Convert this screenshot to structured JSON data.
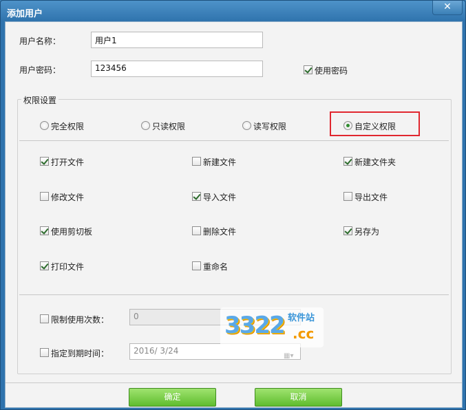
{
  "window": {
    "title": "添加用户",
    "close_glyph": "✕"
  },
  "username": {
    "label": "用户名称：",
    "value": "用户1"
  },
  "password": {
    "label": "用户密码：",
    "value": "123456",
    "use_password_label": "使用密码",
    "use_password_checked": true
  },
  "permissions": {
    "group_title": "权限设置",
    "modes": [
      {
        "label": "完全权限",
        "selected": false
      },
      {
        "label": "只读权限",
        "selected": false
      },
      {
        "label": "读写权限",
        "selected": false
      },
      {
        "label": "自定义权限",
        "selected": true
      }
    ],
    "items": [
      {
        "label": "打开文件",
        "checked": true
      },
      {
        "label": "新建文件",
        "checked": false
      },
      {
        "label": "新建文件夹",
        "checked": true
      },
      {
        "label": "修改文件",
        "checked": false
      },
      {
        "label": "导入文件",
        "checked": true
      },
      {
        "label": "导出文件",
        "checked": false
      },
      {
        "label": "使用剪切板",
        "checked": true
      },
      {
        "label": "删除文件",
        "checked": false
      },
      {
        "label": "另存为",
        "checked": true
      },
      {
        "label": "打印文件",
        "checked": true
      },
      {
        "label": "重命名",
        "checked": false
      }
    ]
  },
  "limits": {
    "usage_limit": {
      "label": "限制使用次数：",
      "value": "0",
      "checked": false
    },
    "expiry": {
      "label": "指定到期时间：",
      "value": "2016/  3/24",
      "checked": false
    }
  },
  "watermark": {
    "number": "3322",
    "suffix": ".cc",
    "site": "软件站"
  },
  "buttons": {
    "ok": "确定",
    "cancel": "取消"
  },
  "colors": {
    "highlight": "#e0262e",
    "button_green": "#5fbd2e",
    "title_blue": "#2f73ad"
  }
}
